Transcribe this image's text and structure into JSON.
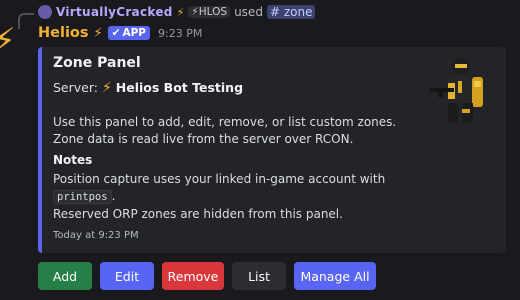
{
  "reply": {
    "username": "VirtuallyCracked",
    "bolt": "⚡",
    "tag": "⚡HLOS",
    "used_text": "used",
    "command": "zone",
    "command_icon": "#"
  },
  "message": {
    "avatar_icon": "⚡",
    "author": "Helios",
    "author_bolt": "⚡",
    "badge_check": "✔",
    "badge": "APP",
    "time": "9:23 PM"
  },
  "embed": {
    "accent_color": "#5865f2",
    "title": "Zone Panel",
    "server_label": "Server:",
    "server_bolt": "⚡",
    "server_name": "Helios Bot Testing",
    "desc_line1": "Use this panel to add, edit, remove, or list custom zones.",
    "desc_line2": "Zone data is read live from the server over RCON.",
    "notes_heading": "Notes",
    "notes_line1": "Position capture uses your linked in-game account with",
    "notes_code": "printpos",
    "notes_line2_suffix": ".",
    "notes_line3": "Reserved ORP zones are hidden from this panel.",
    "footer": "Today at 9:23 PM",
    "thumbnail_icon": "soldier-figure-image"
  },
  "buttons": {
    "add": "Add",
    "edit": "Edit",
    "remove": "Remove",
    "list": "List",
    "manage_all": "Manage All"
  },
  "colors": {
    "background": "#1a1a1e",
    "author": "#f0b232",
    "success": "#248046",
    "primary": "#5865f2",
    "danger": "#da373c",
    "secondary": "#2b2d31"
  }
}
